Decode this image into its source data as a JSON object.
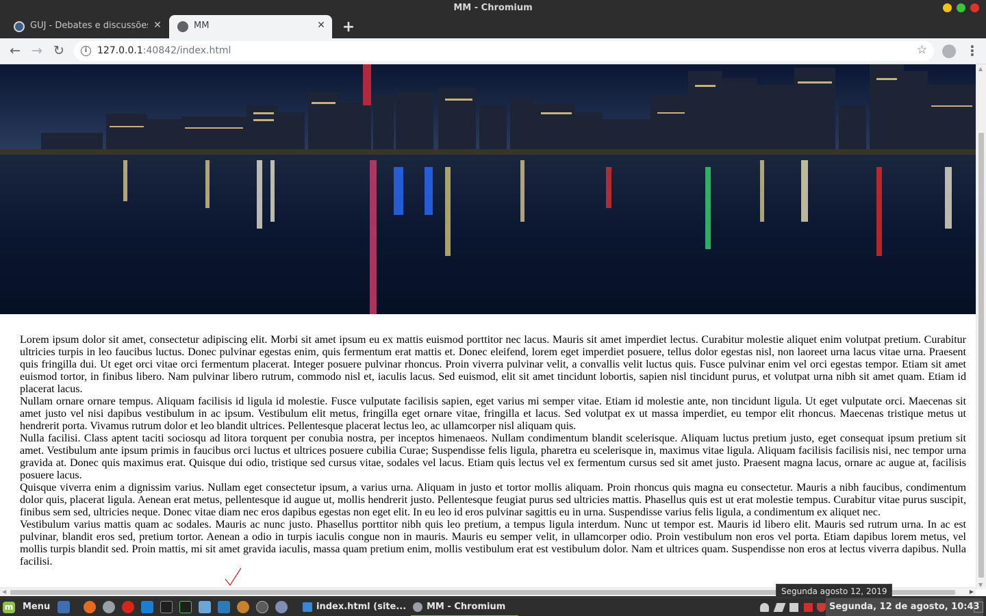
{
  "window": {
    "title": "MM - Chromium"
  },
  "tabs": [
    {
      "title": "GUJ - Debates e discussões sobre",
      "active": false,
      "close": "✕"
    },
    {
      "title": "MM",
      "active": true,
      "close": "✕"
    }
  ],
  "new_tab_symbol": "+",
  "toolbar": {
    "back_icon": "←",
    "forward_icon": "→",
    "reload_icon": "↻",
    "info_icon": "i",
    "url_host": "127.0.0.1",
    "url_rest": ":40842/index.html",
    "bookmark_icon": "☆",
    "menu_icon": "⋮"
  },
  "page": {
    "hero_image": "city-skyline-night-reflection",
    "paragraphs": [
      "Lorem ipsum dolor sit amet, consectetur adipiscing elit. Morbi sit amet ipsum eu ex mattis euismod porttitor nec lacus. Mauris sit amet imperdiet lectus. Curabitur molestie aliquet enim volutpat pretium. Curabitur ultricies turpis in leo faucibus luctus. Donec pulvinar egestas enim, quis fermentum erat mattis et. Donec eleifend, lorem eget imperdiet posuere, tellus dolor egestas nisl, non laoreet urna lacus vitae urna. Praesent quis fringilla dui. Ut eget orci vitae orci fermentum placerat. Integer posuere pulvinar rhoncus. Proin viverra pulvinar velit, a convallis velit luctus quis. Fusce pulvinar enim vel orci egestas tempor. Etiam sit amet euismod tortor, in finibus libero. Nam pulvinar libero rutrum, commodo nisl et, iaculis lacus. Sed euismod, elit sit amet tincidunt lobortis, sapien nisl tincidunt purus, et volutpat urna nibh sit amet quam. Etiam id placerat lacus.",
      "Nullam ornare ornare tempus. Aliquam facilisis id ligula id molestie. Fusce vulputate facilisis sapien, eget varius mi semper vitae. Etiam id molestie ante, non tincidunt ligula. Ut eget vulputate orci. Maecenas sit amet justo vel nisi dapibus vestibulum in ac ipsum. Vestibulum elit metus, fringilla eget ornare vitae, fringilla et lacus. Sed volutpat ex ut massa imperdiet, eu tempor elit rhoncus. Maecenas tristique metus ut hendrerit porta. Vivamus rutrum dolor et leo blandit ultrices. Pellentesque placerat lectus leo, ac ullamcorper nisl aliquam quis.",
      "Nulla facilisi. Class aptent taciti sociosqu ad litora torquent per conubia nostra, per inceptos himenaeos. Nullam condimentum blandit scelerisque. Aliquam luctus pretium justo, eget consequat ipsum pretium sit amet. Vestibulum ante ipsum primis in faucibus orci luctus et ultrices posuere cubilia Curae; Suspendisse felis ligula, pharetra eu scelerisque in, maximus vitae ligula. Aliquam facilisis facilisis nisi, nec tempor urna gravida at. Donec quis maximus erat. Quisque dui odio, tristique sed cursus vitae, sodales vel lacus. Etiam quis lectus vel ex fermentum cursus sed sit amet justo. Praesent magna lacus, ornare ac augue at, facilisis posuere lacus.",
      "Quisque viverra enim a dignissim varius. Nullam eget consectetur ipsum, a varius urna. Aliquam in justo et tortor mollis aliquam. Proin rhoncus quis magna eu consectetur. Mauris a nibh faucibus, condimentum dolor quis, placerat ligula. Aenean erat metus, pellentesque id augue ut, mollis hendrerit justo. Pellentesque feugiat purus sed ultricies mattis. Phasellus quis est ut erat molestie tempus. Curabitur vitae purus suscipit, finibus sem sed, ultricies neque. Donec vitae diam nec eros dapibus egestas non eget elit. In eu leo id eros pulvinar sagittis eu in urna. Suspendisse varius felis ligula, a condimentum ex aliquet nec.",
      "Vestibulum varius mattis quam ac sodales. Mauris ac nunc justo. Phasellus porttitor nibh quis leo pretium, a tempus ligula interdum. Nunc ut tempor est. Mauris id libero elit. Mauris sed rutrum urna. In ac est pulvinar, blandit eros sed, pretium tortor. Aenean a odio in turpis iaculis congue non in mauris. Mauris eu semper velit, in ullamcorper odio. Proin vestibulum non eros vel porta. Etiam dapibus lorem metus, vel mollis turpis blandit sed. Proin mattis, mi sit amet gravida iaculis, massa quam pretium enim, mollis vestibulum erat est vestibulum dolor. Nam et ultrices quam. Suspendisse non eros at lectus viverra dapibus. Nulla facilisi."
    ]
  },
  "tooltip": {
    "text": "Segunda agosto 12, 2019"
  },
  "taskbar": {
    "menu_label": "Menu",
    "launchers": [
      "show-desktop-icon",
      "firefox-icon",
      "chrome-icon",
      "opera-icon",
      "skype-icon",
      "terminal-icon",
      "system-monitor-icon",
      "files-icon",
      "editor-icon",
      "gimp-icon",
      "s-app-icon",
      "bug-icon"
    ],
    "tasks": [
      {
        "label": "index.html (site...",
        "active": false
      },
      {
        "label": "MM - Chromium",
        "active": true
      }
    ],
    "clock": "Segunda, 12 de agosto, 10:43"
  },
  "colors": {
    "accent": "#8bc34a",
    "titlebar": "#2d2d2d",
    "toolbar": "#f1f3f4"
  }
}
